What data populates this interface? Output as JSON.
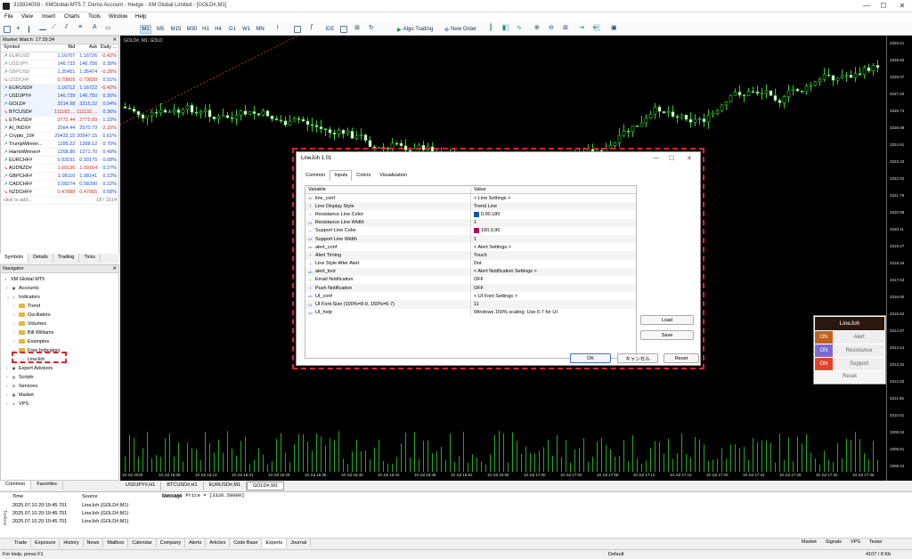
{
  "window": {
    "title": "315924059 - XMGlobal-MT5 7: Demo Account - Hedge - XM Global Limited - [GOLD#,M1]",
    "min": "—",
    "max": "☐",
    "close": "✕"
  },
  "menu": [
    "File",
    "View",
    "Insert",
    "Charts",
    "Tools",
    "Window",
    "Help"
  ],
  "toolbar": {
    "timeframes": [
      "M1",
      "M5",
      "M15",
      "M30",
      "H1",
      "H4",
      "D1",
      "W1",
      "MN"
    ],
    "ide": "IDE",
    "algo": "Algo Trading",
    "new_order": "New Order"
  },
  "market_watch": {
    "title": "Market Watch: 17:39:34",
    "headers": [
      "Symbol",
      "Bid",
      "Ask",
      "Daily ..."
    ],
    "rows": [
      {
        "s": "EURUSD",
        "b": "1.16707",
        "a": "1.16726",
        "d": "-0.42%",
        "dir": "up",
        "grey": true
      },
      {
        "s": "USDJPY",
        "b": "146.733",
        "a": "146.756",
        "d": "0.30%",
        "dir": "up",
        "grey": true
      },
      {
        "s": "GBPUSD",
        "b": "1.35451",
        "a": "1.35474",
        "d": "-0.28%",
        "dir": "up",
        "grey": true
      },
      {
        "s": "USDCHF",
        "b": "0.79809",
        "a": "0.79830",
        "d": "0.51%",
        "dir": "dn",
        "grey": true
      },
      {
        "s": "EURUSD#",
        "b": "1.16712",
        "a": "1.16722",
        "d": "-0.42%",
        "dir": "up",
        "grey": false
      },
      {
        "s": "USDJPY#",
        "b": "146.739",
        "a": "146.750",
        "d": "0.30%",
        "dir": "up",
        "grey": false
      },
      {
        "s": "GOLD#",
        "b": "3314.98",
        "a": "3315.22",
        "d": "0.04%",
        "dir": "up",
        "grey": false
      },
      {
        "s": "BTCUSD#",
        "b": "111102....",
        "a": "111132....",
        "d": "0.36%",
        "dir": "dn",
        "grey": false
      },
      {
        "s": "ETHUSD#",
        "b": "2772.44",
        "a": "2775.89",
        "d": "1.33%",
        "dir": "dn",
        "grey": false
      },
      {
        "s": "AI_INDX#",
        "b": "2564.44",
        "a": "2570.79",
        "d": "-2.16%",
        "dir": "up",
        "grey": false
      },
      {
        "s": "Crypto_10#",
        "b": "20432.15",
        "a": "20547.15",
        "d": "0.61%",
        "dir": "up",
        "grey": false
      },
      {
        "s": "TrumpWinner...",
        "b": "1285.22",
        "a": "1288.12",
        "d": "0.70%",
        "dir": "up",
        "grey": false
      },
      {
        "s": "HarrisWinner#",
        "b": "1268.80",
        "a": "1271.70",
        "d": "0.49%",
        "dir": "up",
        "grey": false
      },
      {
        "s": "EURCHF#",
        "b": "0.93151",
        "a": "0.93175",
        "d": "0.08%",
        "dir": "up",
        "grey": false
      },
      {
        "s": "AUDNZD#",
        "b": "1.09136",
        "a": "1.09164",
        "d": "0.27%",
        "dir": "dn",
        "grey": false
      },
      {
        "s": "GBPCHF#",
        "b": "1.08110",
        "a": "1.08141",
        "d": "0.22%",
        "dir": "up",
        "grey": false
      },
      {
        "s": "CADCHF#",
        "b": "0.58274",
        "a": "0.58290",
        "d": "0.22%",
        "dir": "up",
        "grey": false
      },
      {
        "s": "NZDCHF#",
        "b": "0.47888",
        "a": "0.47905",
        "d": "0.58%",
        "dir": "dn",
        "grey": false
      }
    ],
    "add": "click to add...",
    "count": "18 / 1514",
    "tabs": [
      "Symbols",
      "Details",
      "Trading",
      "Ticks"
    ]
  },
  "navigator": {
    "title": "Navigator",
    "items": [
      "XM Global MT5",
      "Accounts",
      "Indicators",
      "Trend",
      "Oscillators",
      "Volumes",
      "Bill Williams",
      "Examples",
      "Free Indicators",
      "LineJoh",
      "Expert Advisors",
      "Scripts",
      "Services",
      "Market",
      "VPS"
    ],
    "tabs": [
      "Common",
      "Favorites"
    ]
  },
  "chart": {
    "label": "GOLD#, M1: GOLD",
    "prices": [
      "3329.01",
      "3328.60",
      "3328.07",
      "3327.20",
      "3326.73",
      "3325.98",
      "3324.91",
      "3323.43",
      "3322.62",
      "3321.79",
      "3320.98",
      "3320.11",
      "3319.27",
      "3318.46",
      "3317.63",
      "3316.80",
      "3315.52",
      "3314.97",
      "3314.14",
      "3313.32",
      "3312.50",
      "3311.65",
      "3310.81",
      "3309.04",
      "3309.81",
      "3308.42"
    ],
    "times": [
      "10 Jul 2025",
      "10 Jul 16:05",
      "10 Jul 16:13",
      "10 Jul 16:21",
      "10 Jul 16:29",
      "10 Jul 16:35",
      "10 Jul 16:40",
      "10 Jul 16:44",
      "10 Jul 16:48",
      "10 Jul 16:52",
      "10 Jul 16:56",
      "10 Jul 17:00",
      "10 Jul 17:04",
      "10 Jul 17:08",
      "10 Jul 17:12",
      "10 Jul 17:16",
      "10 Jul 17:20",
      "10 Jul 17:24",
      "10 Jul 17:28",
      "10 Jul 17:32",
      "10 Jul 17:36"
    ],
    "tabs": [
      "USDJPY#,H1",
      "BTCUSD#,H1",
      "EURUSD#,M1",
      "GOLD#,M1"
    ]
  },
  "dialog": {
    "title": "LineJoh 1.01",
    "tabs": [
      "Common",
      "Inputs",
      "Colors",
      "Visualization"
    ],
    "col_var": "Variable",
    "col_val": "Value",
    "params": [
      {
        "v": "line_conf",
        "val": "< Line Settings >",
        "i": "ab"
      },
      {
        "v": "Line Display Style",
        "val": "Trend Line",
        "i": "en"
      },
      {
        "v": "Resistance Line Color",
        "val": "0,90,180",
        "i": "cl",
        "sw": "#005ab4"
      },
      {
        "v": "Resistance Line Width",
        "val": "1",
        "i": "01"
      },
      {
        "v": "Support Line Color",
        "val": "180,0,90",
        "i": "cl",
        "sw": "#b4005a"
      },
      {
        "v": "Support Line Width",
        "val": "1",
        "i": "01"
      },
      {
        "v": "alert_conf",
        "val": "< Alert Settings >",
        "i": "ab"
      },
      {
        "v": "Alert Timing",
        "val": "Touch",
        "i": "en"
      },
      {
        "v": "Line Style After Alert",
        "val": "Dot",
        "i": "en"
      },
      {
        "v": "alert_tool",
        "val": "< Alert Notification Settings >",
        "i": "ab"
      },
      {
        "v": "Email Notification",
        "val": "OFF",
        "i": "en"
      },
      {
        "v": "Push Notification",
        "val": "OFF",
        "i": "en"
      },
      {
        "v": "UI_conf",
        "val": "< UI Font Settings >",
        "i": "ab"
      },
      {
        "v": "UI Font Size (100%=8-9, 150%=6-7)",
        "val": "11",
        "i": "01"
      },
      {
        "v": "UI_help",
        "val": "Windows 150% scaling: Use 6-7 for UI",
        "i": "ab"
      }
    ],
    "load": "Load",
    "save": "Save",
    "ok": "OK",
    "cancel": "キャンセル",
    "reset": "Reset"
  },
  "linejoh_panel": {
    "title": "LineJoh",
    "rows": [
      {
        "on": "ON",
        "label": "Alert",
        "color": "#c0621a"
      },
      {
        "on": "ON",
        "label": "Resistance",
        "color": "#7b6ad0"
      },
      {
        "on": "ON",
        "label": "Support",
        "color": "#e0442a"
      }
    ],
    "reset": "Reset"
  },
  "toolbox": {
    "headers": [
      "Time",
      "Source",
      "Message"
    ],
    "logs": [
      {
        "t": "2025.07.10 20:19:45.701",
        "s": "LineJoh (GOLD#,M1)",
        "m": "Current Price = [3326.58000]"
      },
      {
        "t": "2025.07.10 20:19:45.701",
        "s": "LineJoh (GOLD#,M1)",
        "m": ""
      },
      {
        "t": "2025.07.10 20:19:45.701",
        "s": "LineJoh (GOLD#,M1)",
        "m": ""
      }
    ],
    "tabs": [
      "Trade",
      "Exposure",
      "History",
      "News",
      "Mailbox",
      "Calendar",
      "Company",
      "Alerts",
      "Articles",
      "Code Base",
      "Experts",
      "Journal"
    ],
    "right": [
      "Market",
      "Signals",
      "VPS",
      "Tester"
    ]
  },
  "status": {
    "help": "For Help, press F1",
    "profile": "Default",
    "net": "4107 / 8 Kb"
  }
}
